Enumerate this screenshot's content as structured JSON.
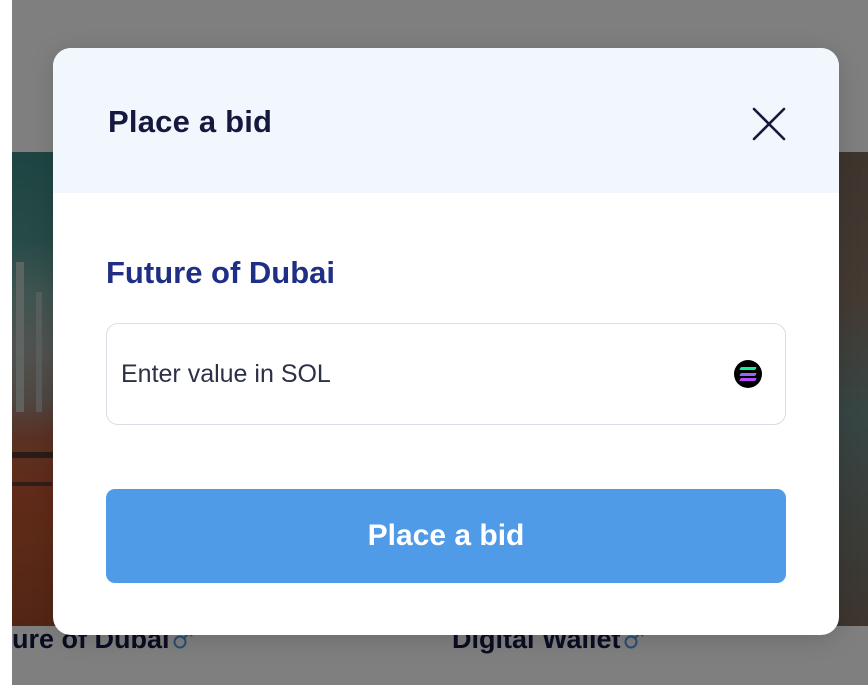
{
  "background": {
    "cards": [
      {
        "title": "ure of Dubai"
      },
      {
        "title": "Digital Wallet"
      }
    ]
  },
  "modal": {
    "title": "Place a bid",
    "item_name": "Future of Dubai",
    "bid_input": {
      "value": "",
      "placeholder": "Enter value in SOL",
      "currency_icon": "solana-icon"
    },
    "submit_label": "Place a bid",
    "close_icon": "close-icon"
  },
  "colors": {
    "overlay": "#000000",
    "header_bg": "#f2f7fd",
    "title": "#14193d",
    "item_title": "#1f2f86",
    "button": "#4f9be8",
    "button_text": "#ffffff"
  }
}
